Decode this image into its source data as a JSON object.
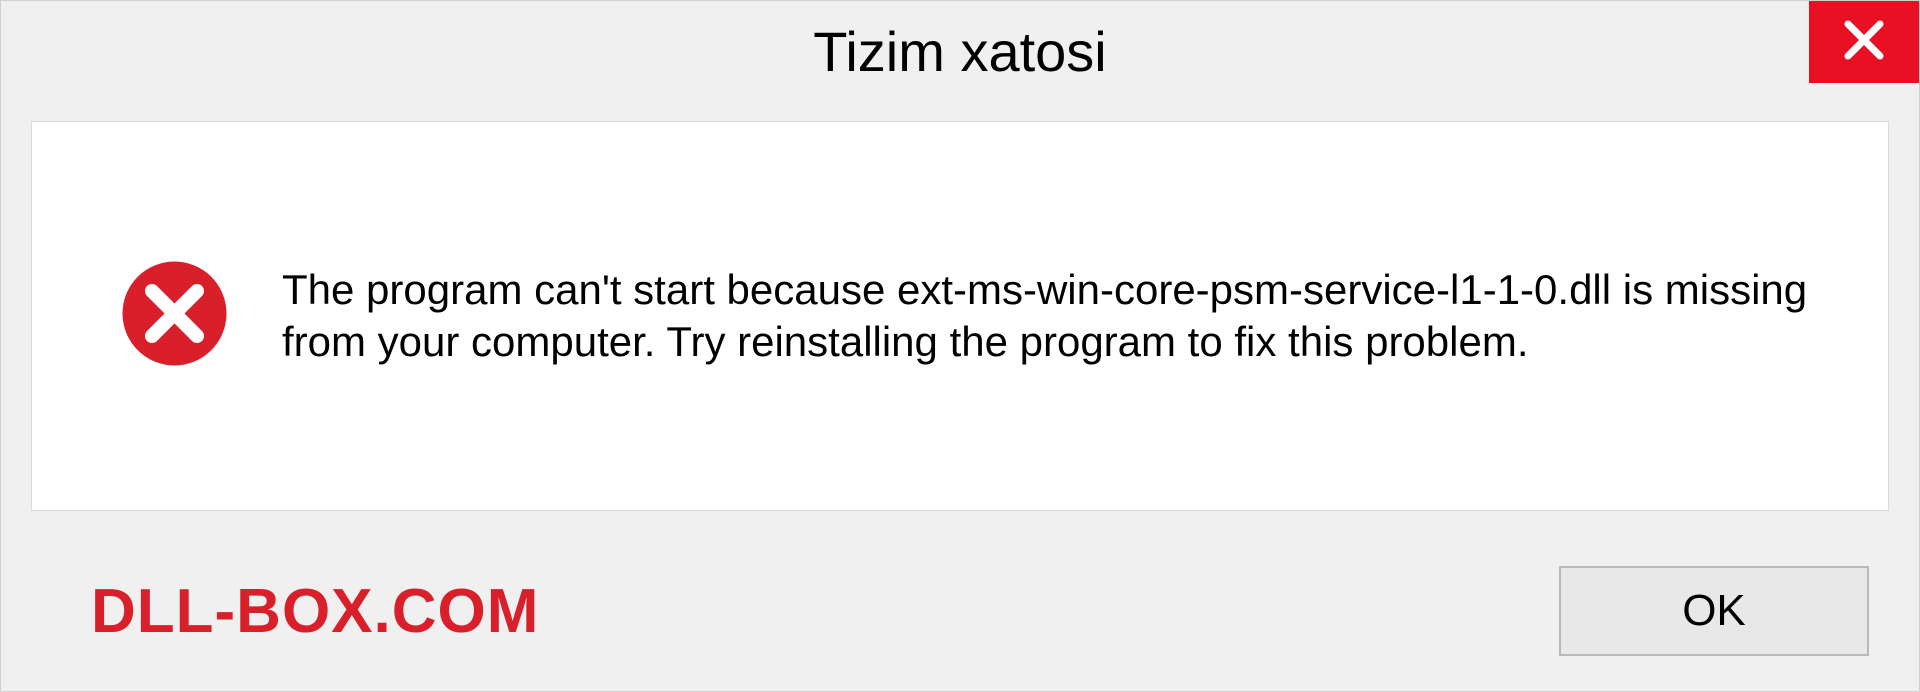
{
  "titlebar": {
    "title": "Tizim xatosi"
  },
  "content": {
    "message": "The program can't start because ext-ms-win-core-psm-service-l1-1-0.dll is missing from your computer. Try reinstalling the program to fix this problem."
  },
  "footer": {
    "watermark": "DLL-BOX.COM",
    "ok_label": "OK"
  }
}
